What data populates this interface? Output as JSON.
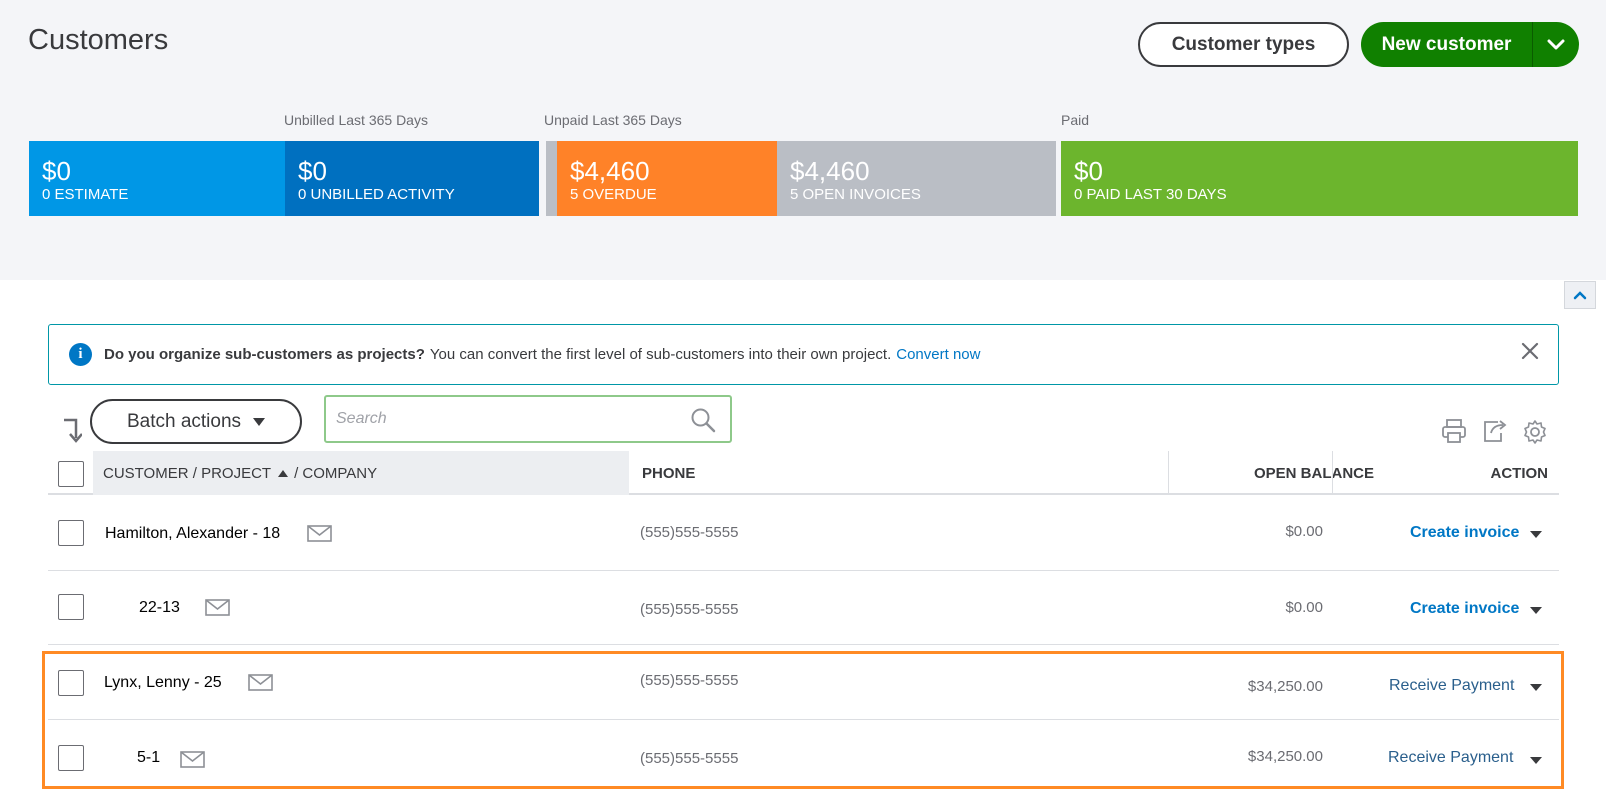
{
  "page": {
    "title": "Customers"
  },
  "header_buttons": {
    "customer_types": "Customer types",
    "new_customer": "New customer"
  },
  "money_bar": {
    "labels": {
      "unbilled": "Unbilled Last 365 Days",
      "unpaid": "Unpaid Last 365 Days",
      "paid": "Paid"
    },
    "segments": [
      {
        "amount": "$0",
        "caption": "0 ESTIMATE",
        "color": "#0097e6"
      },
      {
        "amount": "$0",
        "caption": "0 UNBILLED ACTIVITY",
        "color": "#0070c0"
      },
      {
        "amount": "$4,460",
        "caption": "5 OVERDUE",
        "color": "#ff8228"
      },
      {
        "amount": "$4,460",
        "caption": "5 OPEN INVOICES",
        "color": "#babec5"
      },
      {
        "amount": "$0",
        "caption": "0 PAID LAST 30 DAYS",
        "color": "#6cb52d"
      }
    ]
  },
  "banner": {
    "bold": "Do you organize sub-customers as projects?",
    "text": "You can convert the first level of sub-customers into their own project.",
    "link": "Convert now"
  },
  "toolbar": {
    "batch_actions": "Batch actions",
    "search_placeholder": "Search"
  },
  "table": {
    "headers": {
      "customer": "CUSTOMER / PROJECT",
      "company": "/ COMPANY",
      "phone": "PHONE",
      "balance": "OPEN BALANCE",
      "action": "ACTION"
    },
    "rows": [
      {
        "name": "Hamilton, Alexander - 18",
        "phone": "(555)555-5555",
        "balance": "$0.00",
        "action": "Create invoice"
      },
      {
        "name": "22-13",
        "phone": "(555)555-5555",
        "balance": "$0.00",
        "action": "Create invoice"
      },
      {
        "name": "Lynx, Lenny - 25",
        "phone": "(555)555-5555",
        "balance": "$34,250.00",
        "action": "Receive Payment"
      },
      {
        "name": "5-1",
        "phone": "(555)555-5555",
        "balance": "$34,250.00",
        "action": "Receive Payment"
      }
    ]
  },
  "colors": {
    "accent_green": "#108000",
    "link_blue": "#0077c5",
    "highlight": "#ff8a24"
  }
}
